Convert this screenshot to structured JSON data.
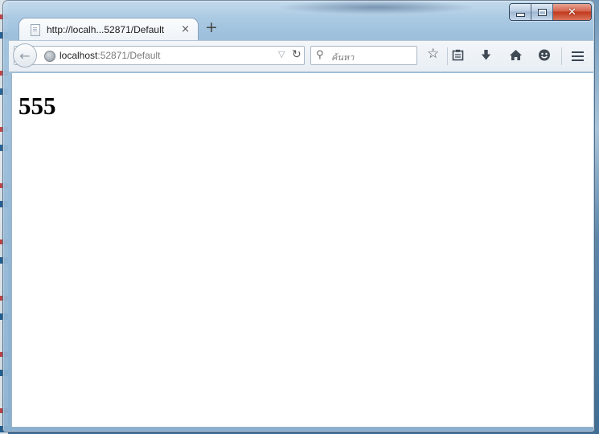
{
  "window": {
    "minimize_label": "",
    "maximize_label": "",
    "close_label": "✕"
  },
  "tab": {
    "title": "http://localh...52871/Default",
    "close": "×",
    "new_tab": "+"
  },
  "navbar": {
    "back": "←",
    "url_host": "localhost",
    "url_rest": ":52871/Default",
    "dropmarker": "▽",
    "reload": "↻",
    "search_icon": "⚲",
    "search_placeholder": "ค้นหา",
    "toolbar_icons": [
      "star-icon",
      "reading-list-icon",
      "download-icon",
      "home-icon",
      "hello-icon",
      "menu-icon"
    ]
  },
  "page": {
    "heading": "555"
  }
}
